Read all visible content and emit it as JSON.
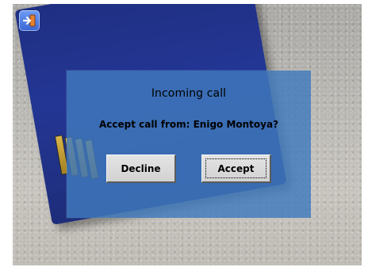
{
  "dialog": {
    "title": "Incoming call",
    "message": "Accept call from: Enigo Montoya?",
    "buttons": {
      "decline_label": "Decline",
      "accept_label": "Accept"
    }
  },
  "colors": {
    "dialog_background": "#3f7abd",
    "card_blue": "#233694",
    "button_face": "#d8d8d8",
    "icon_orange": "#e7822e"
  },
  "icons": {
    "app_icon": "login-arrow-icon"
  }
}
